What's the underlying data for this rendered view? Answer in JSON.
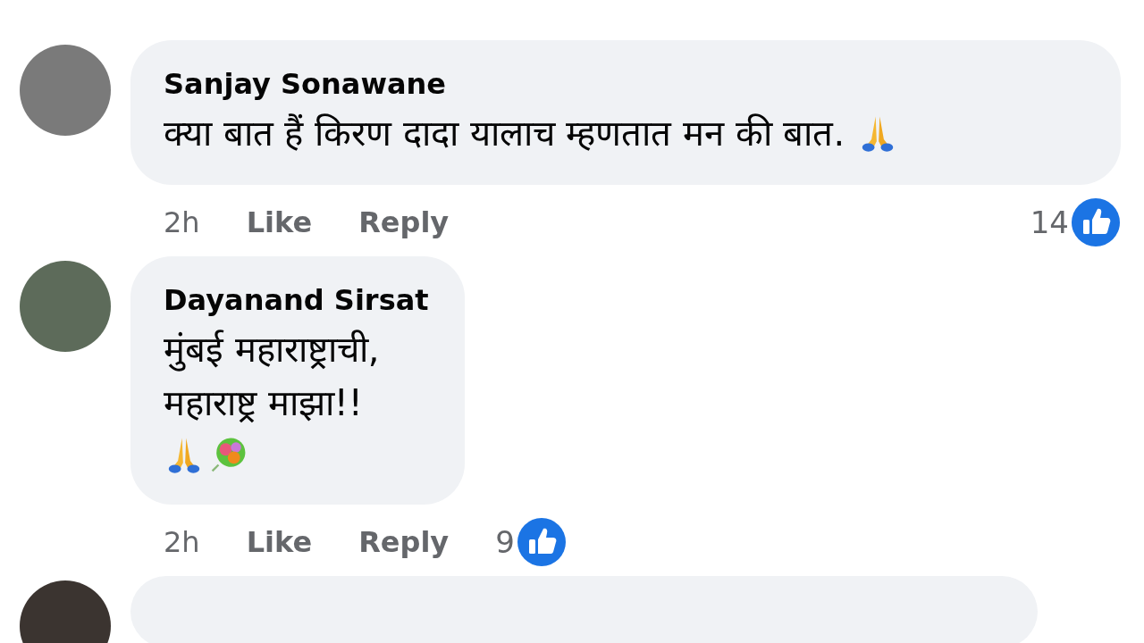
{
  "comments": [
    {
      "author": "Sanjay Sonawane",
      "lines": [
        {
          "text": "क्या बात हैं किरण दादा यालाच म्हणतात मन की बात.",
          "emojis": [
            {
              "kind": "pray"
            }
          ]
        }
      ],
      "time": "2h",
      "like_label": "Like",
      "reply_label": "Reply",
      "reaction_count": "14"
    },
    {
      "author": "Dayanand Sirsat",
      "lines": [
        {
          "text": "मुंबई महाराष्ट्राची,"
        },
        {
          "text": "महाराष्ट्र माझा!!"
        },
        {
          "emojis": [
            {
              "kind": "pray"
            },
            {
              "kind": "bouquet"
            }
          ]
        }
      ],
      "time": "2h",
      "like_label": "Like",
      "reply_label": "Reply",
      "reaction_count": "9"
    }
  ]
}
